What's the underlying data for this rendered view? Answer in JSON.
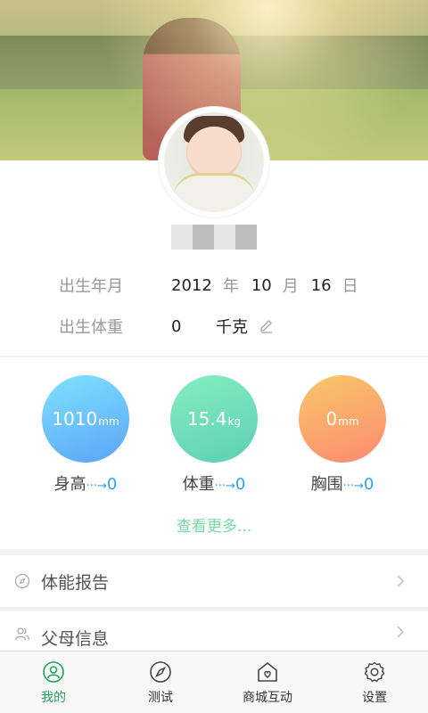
{
  "profile": {
    "banner_image": "child-running-in-park-photo",
    "avatar_image": "baby-portrait-photo"
  },
  "info": {
    "birth_label": "出生年月",
    "birth_year": "2012",
    "year_unit": "年",
    "birth_month": "10",
    "month_unit": "月",
    "birth_day": "16",
    "day_unit": "日",
    "weight_label": "出生体重",
    "weight_value": "0",
    "weight_unit": "千克"
  },
  "metrics": [
    {
      "value": "1010",
      "unit": "mm",
      "label": "身高",
      "arrow": "···→",
      "change": "0",
      "color_from": "#7fe0ff",
      "color_to": "#5aa7f6"
    },
    {
      "value": "15.4",
      "unit": "kg",
      "label": "体重",
      "arrow": "···→",
      "change": "0",
      "color_from": "#7fecc0",
      "color_to": "#5fd0b0"
    },
    {
      "value": "0",
      "unit": "mm",
      "label": "胸围",
      "arrow": "···→",
      "change": "0",
      "color_from": "#f6c36a",
      "color_to": "#fd8d6f"
    }
  ],
  "more_link": "查看更多...",
  "menu": [
    {
      "label": "体能报告",
      "icon": "compass-icon"
    },
    {
      "label": "父母信息",
      "icon": "parents-icon"
    }
  ],
  "tabs": [
    {
      "label": "我的",
      "icon": "profile-icon",
      "active": true
    },
    {
      "label": "测试",
      "icon": "compass-icon",
      "active": false
    },
    {
      "label": "商城互动",
      "icon": "shop-icon",
      "active": false
    },
    {
      "label": "设置",
      "icon": "settings-icon",
      "active": false
    }
  ],
  "colors": {
    "accent": "#20a45a",
    "link": "#2da1f5",
    "more": "#7ad7a6"
  }
}
